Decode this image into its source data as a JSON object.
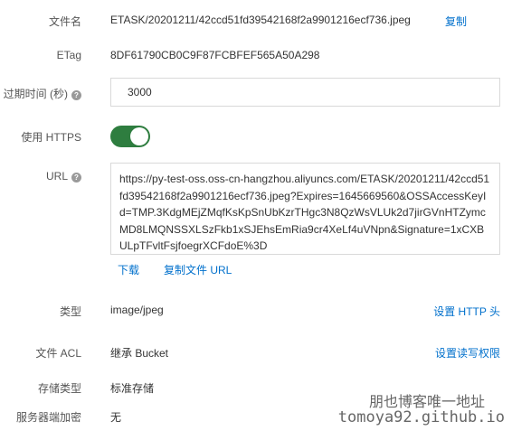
{
  "fields": {
    "filename": {
      "label": "文件名",
      "value": "ETASK/20201211/42ccd51fd39542168f2a9901216ecf736.jpeg",
      "action": "复制"
    },
    "etag": {
      "label": "ETag",
      "value": "8DF61790CB0C9F87FCBFEF565A50A298"
    },
    "expire": {
      "label": "过期时间 (秒)",
      "help_icon": "question-circle-icon",
      "value": "3000"
    },
    "https": {
      "label": "使用 HTTPS",
      "enabled": true,
      "toggle_color": "#2e7d3f"
    },
    "url": {
      "label": "URL",
      "help_icon": "question-circle-icon",
      "value": "https://py-test-oss.oss-cn-hangzhou.aliyuncs.com/ETASK/20201211/42ccd51fd39542168f2a9901216ecf736.jpeg?Expires=1645669560&OSSAccessKeyId=TMP.3KdgMEjZMqfKsKpSnUbKzrTHgc3N8QzWsVLUk2d7jirGVnHTZymcMD8LMQNSSXLSzFkb1xSJEhsEmRia9cr4XeLf4uVNpn&Signature=1xCXBULpTFvltFsjfoegrXCFdoE%3D",
      "download": "下载",
      "copy": "复制文件 URL"
    },
    "type": {
      "label": "类型",
      "value": "image/jpeg",
      "action": "设置 HTTP 头"
    },
    "acl": {
      "label": "文件 ACL",
      "value": "继承 Bucket",
      "action": "设置读写权限"
    },
    "storage": {
      "label": "存储类型",
      "value": "标准存储"
    },
    "encryption": {
      "label": "服务器端加密",
      "value": "无"
    }
  },
  "watermark": {
    "line1": "朋也博客唯一地址",
    "line2": "tomoya92.github.io"
  },
  "colors": {
    "link": "#0070cc",
    "label": "#555555",
    "text": "#333333"
  }
}
